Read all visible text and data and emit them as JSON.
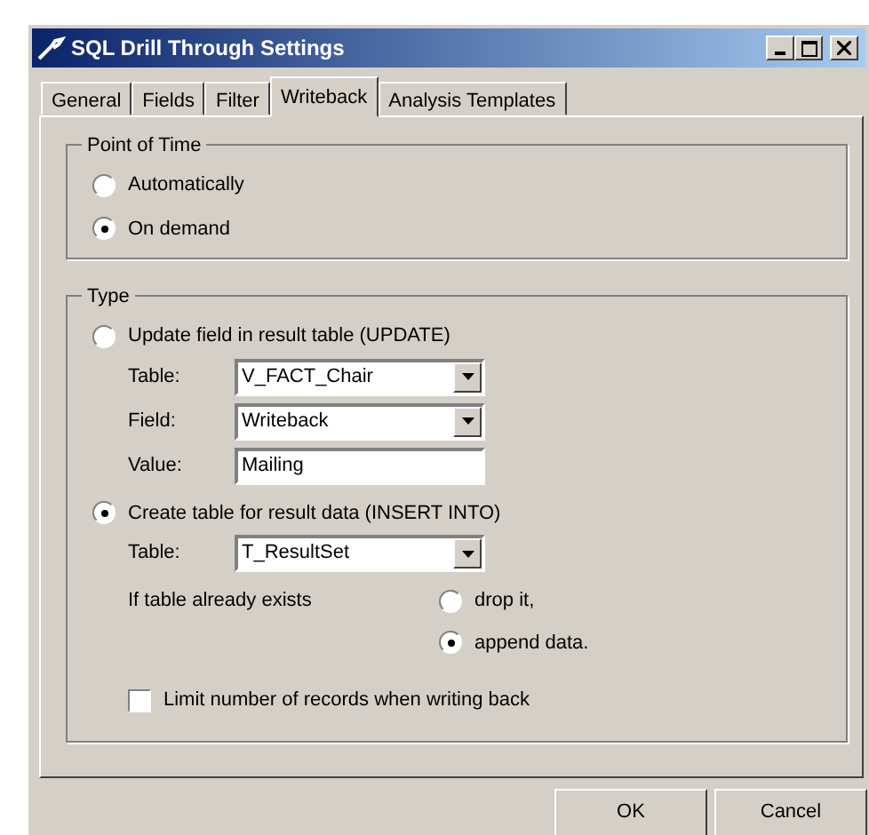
{
  "window": {
    "title": "SQL Drill Through Settings"
  },
  "tabs": [
    {
      "label": "General",
      "selected": false
    },
    {
      "label": "Fields",
      "selected": false
    },
    {
      "label": "Filter",
      "selected": false
    },
    {
      "label": "Writeback",
      "selected": true
    },
    {
      "label": "Analysis Templates",
      "selected": false
    }
  ],
  "point_of_time": {
    "title": "Point of Time",
    "options": [
      {
        "label": "Automatically",
        "selected": false
      },
      {
        "label": "On demand",
        "selected": true
      }
    ]
  },
  "type": {
    "title": "Type",
    "options": [
      {
        "label": "Update field in result table (UPDATE)",
        "selected": false,
        "fields": [
          {
            "label": "Table:",
            "kind": "dropdown",
            "value": "V_FACT_Chair"
          },
          {
            "label": "Field:",
            "kind": "dropdown",
            "value": "Writeback"
          },
          {
            "label": "Value:",
            "kind": "text",
            "value": "Mailing"
          }
        ]
      },
      {
        "label": "Create table for result data (INSERT INTO)",
        "selected": true,
        "fields": [
          {
            "label": "Table:",
            "kind": "dropdown",
            "value": "T_ResultSet"
          }
        ],
        "if_exists": {
          "label": "If table already exists",
          "options": [
            {
              "label": "drop it,",
              "selected": false
            },
            {
              "label": "append data.",
              "selected": true
            }
          ]
        }
      }
    ],
    "limit": {
      "label": "Limit number of records when writing back",
      "checked": false
    }
  },
  "buttons": [
    "OK",
    "Cancel"
  ]
}
